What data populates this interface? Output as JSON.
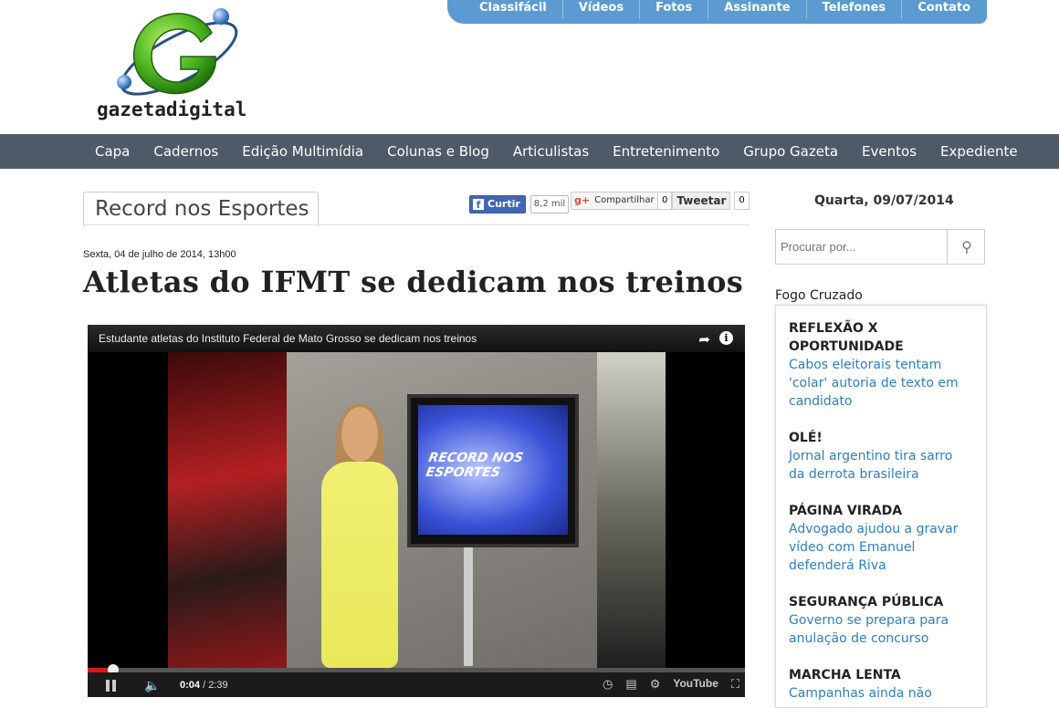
{
  "top_links": [
    "Classifácil",
    "Vídeos",
    "Fotos",
    "Assinante",
    "Telefones",
    "Contato"
  ],
  "logo": {
    "text": "gazetadigital"
  },
  "main_nav": [
    "Capa",
    "Cadernos",
    "Edição Multimídia",
    "Colunas e Blog",
    "Articulistas",
    "Entretenimento",
    "Grupo Gazeta",
    "Eventos",
    "Expediente"
  ],
  "section": {
    "title": "Record nos Esportes"
  },
  "social": {
    "facebook_label": "Curtir",
    "facebook_count": "8,2 mil",
    "gplus_label": "Compartilhar",
    "gplus_count": "0",
    "twitter_label": "Tweetar",
    "twitter_count": "0"
  },
  "article": {
    "date": "Sexta, 04 de julho de 2014, 13h00",
    "headline": "Atletas do IFMT se dedicam nos treinos"
  },
  "video": {
    "title": "Estudante atletas do Instituto Federal de Mato Grosso se dedicam nos treinos",
    "current_time": "0:04",
    "duration": "2:39",
    "progress_fraction": 0.025,
    "brand": "YouTube",
    "tv_overlay_text": "RECORD NOS ESPORTES"
  },
  "sidebar": {
    "date": "Quarta, 09/07/2014",
    "search_placeholder": "Procurar por...",
    "fogo_title": "Fogo Cruzado",
    "fogo_items": [
      {
        "kicker": "REFLEXÃO X OPORTUNIDADE",
        "link": "Cabos eleitorais tentam 'colar' autoria de texto em candidato"
      },
      {
        "kicker": "OLÉ!",
        "link": "Jornal argentino tira sarro da derrota brasileira"
      },
      {
        "kicker": "PÁGINA VIRADA",
        "link": "Advogado ajudou a gravar vídeo com Emanuel defenderá Riva"
      },
      {
        "kicker": "SEGURANÇA PÚBLICA",
        "link": "Governo se prepara para anulação de concurso"
      },
      {
        "kicker": "MARCHA LENTA",
        "link": "Campanhas ainda não"
      }
    ]
  },
  "colors": {
    "nav_bg": "#4e5a67",
    "top_links_bg": "#5b9bd1",
    "link": "#2d7fc1",
    "facebook": "#4267b2"
  }
}
